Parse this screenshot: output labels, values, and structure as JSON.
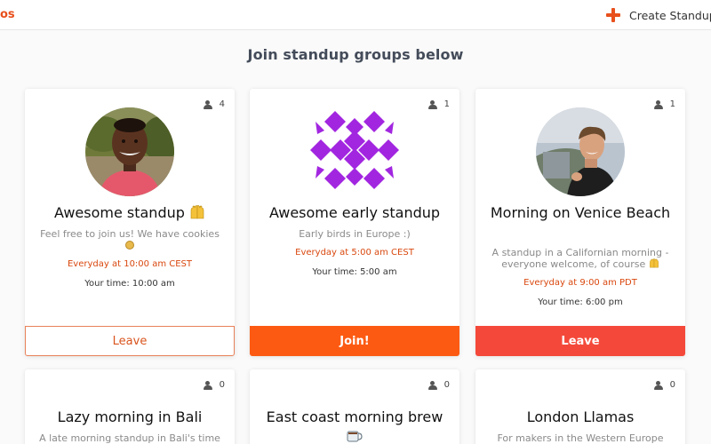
{
  "topbar": {
    "brand_fragment": "os",
    "create_label": "Create Standup G"
  },
  "page": {
    "heading": "Join standup groups below"
  },
  "groups": [
    {
      "title": "Awesome standup",
      "title_emoji": "raising-hands-icon",
      "description": "Feel free to join us! We have cookies",
      "description_emoji": "cookie-icon",
      "schedule": "Everyday at 10:00 am CEST",
      "your_time": "Your time: 10:00 am",
      "members": "4",
      "action": "Leave",
      "action_style": "outline"
    },
    {
      "title": "Awesome early standup",
      "description": "Early birds in Europe :)",
      "schedule": "Everyday at 5:00 am CEST",
      "your_time": "Your time: 5:00 am",
      "members": "1",
      "action": "Join!",
      "action_style": "join"
    },
    {
      "title": "Morning on Venice Beach",
      "description": "A standup in a Californian morning - everyone welcome, of course",
      "description_emoji": "raising-hands-icon",
      "schedule": "Everyday at 9:00 am PDT",
      "your_time": "Your time: 6:00 pm",
      "members": "1",
      "action": "Leave",
      "action_style": "solid"
    },
    {
      "title": "Lazy morning in Bali",
      "description": "A late morning standup in Bali's time",
      "members": "0"
    },
    {
      "title": "East coast morning brew",
      "title_emoji": "coffee-mug-icon",
      "members": "0"
    },
    {
      "title": "London Llamas",
      "description": "For makers in the Western Europe",
      "members": "0"
    }
  ],
  "colors": {
    "accent": "#fc5a12",
    "leave_solid": "#f4493a",
    "schedule_text": "#d9480f",
    "identicon": "#a226e0"
  }
}
